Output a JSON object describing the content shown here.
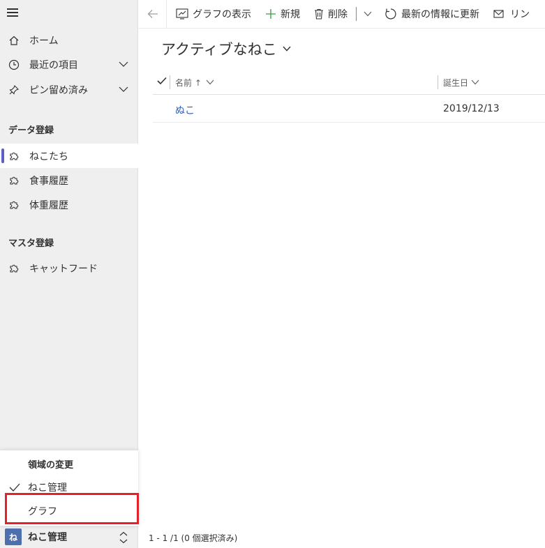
{
  "sidebar": {
    "home": "ホーム",
    "recent": "最近の項目",
    "pinned": "ピン留め済み",
    "group1_title": "データ登録",
    "group1_items": [
      "ねこたち",
      "食事履歴",
      "体重履歴"
    ],
    "group2_title": "マスタ登録",
    "group2_items": [
      "キャットフード"
    ],
    "selected_item": "ねこたち"
  },
  "area_menu": {
    "title": "領域の変更",
    "items": [
      "ねこ管理",
      "グラフ"
    ],
    "checked": "ねこ管理",
    "highlighted": "グラフ"
  },
  "area_switcher": {
    "avatar": "ね",
    "label": "ねこ管理"
  },
  "commandbar": {
    "show_chart": "グラフの表示",
    "new": "新規",
    "delete": "削除",
    "refresh": "最新の情報に更新",
    "link": "リン"
  },
  "view": {
    "title": "アクティブなねこ"
  },
  "grid": {
    "columns": [
      "名前 ↑",
      "誕生日"
    ],
    "rows": [
      {
        "name": "ぬこ",
        "birthday": "2019/12/13"
      }
    ]
  },
  "footer": {
    "status": "1 - 1 /1 (0 個選択済み)"
  },
  "colors": {
    "accent": "#5b5fc7",
    "link": "#2f5fb3",
    "highlight": "#e3202b",
    "avatar_bg": "#4e6fae"
  }
}
